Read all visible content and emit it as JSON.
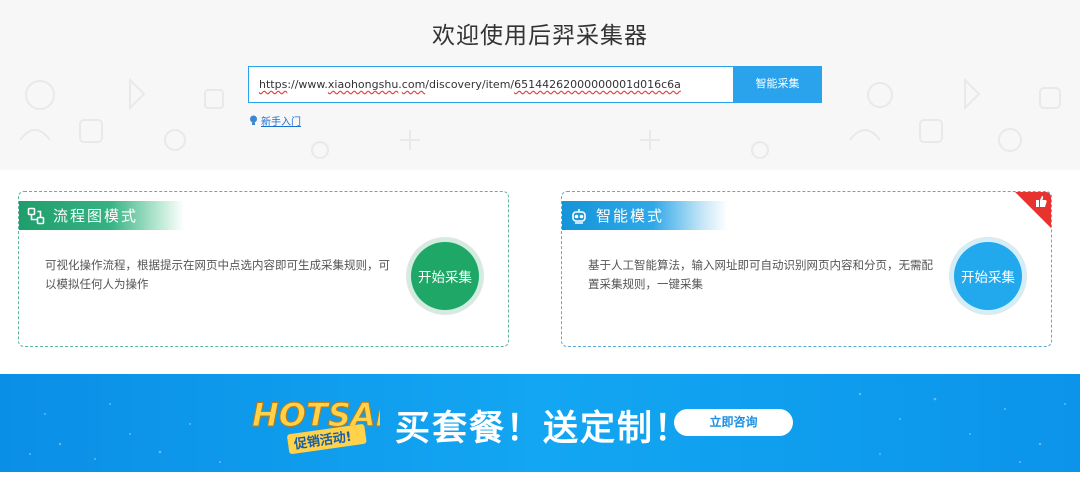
{
  "hero": {
    "title": "欢迎使用后羿采集器",
    "url_value_parts": {
      "p1": "https",
      "p2": "://www.",
      "p3": "xiaohongshu",
      "p4": ".",
      "p5": "com",
      "p6": "/discovery/item/",
      "p7": "65144262000000001d016c6a"
    },
    "smart_button": "智能采集",
    "newbie_link": "新手入门"
  },
  "cards": {
    "flow": {
      "title": "流程图模式",
      "icon": "flowchart-icon",
      "description": "可视化操作流程，根据提示在网页中点选内容即可生成采集规则，可以模拟任何人为操作",
      "button": "开始采集",
      "accent": "#1ea767"
    },
    "smart": {
      "title": "智能模式",
      "icon": "robot-icon",
      "description": "基于人工智能算法，输入网址即可自动识别网页内容和分页，无需配置采集规则，一键采集",
      "button": "开始采集",
      "accent": "#22a8ec",
      "badge_icon": "thumbs-up-icon",
      "badge_color": "#e8322d"
    }
  },
  "banner": {
    "logo_big": "HOTSALE",
    "logo_small": "促销活动!",
    "headline": "买套餐！送定制！",
    "button": "立即咨询"
  }
}
